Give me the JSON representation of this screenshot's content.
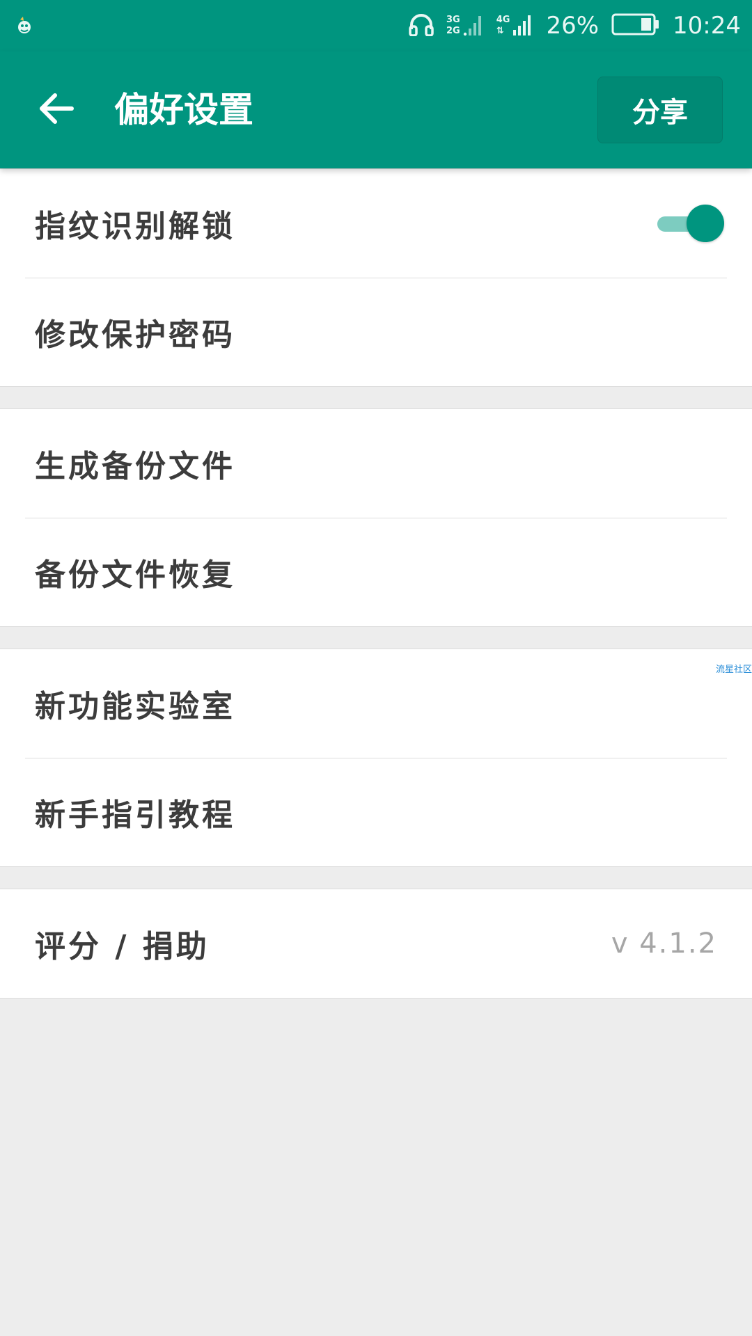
{
  "status_bar": {
    "network_1": [
      "3G",
      "2G"
    ],
    "network_2": "4G",
    "battery_percent": "26%",
    "battery_level": 0.26,
    "time": "10:24",
    "icons": [
      "notification-app-icon",
      "headphones-icon",
      "signal-icon",
      "battery-icon"
    ]
  },
  "app_bar": {
    "title": "偏好设置",
    "back_icon": "arrow-left-icon",
    "share_label": "分享"
  },
  "sections": [
    {
      "items": [
        {
          "label": "指纹识别解锁",
          "toggle_on": true
        },
        {
          "label": "修改保护密码"
        }
      ]
    },
    {
      "items": [
        {
          "label": "生成备份文件"
        },
        {
          "label": "备份文件恢复"
        }
      ]
    },
    {
      "items": [
        {
          "label": "新功能实验室"
        },
        {
          "label": "新手指引教程"
        }
      ]
    },
    {
      "items": [
        {
          "label": "评分 / 捐助",
          "value": "v 4.1.2"
        }
      ]
    }
  ],
  "watermark": "流星社区",
  "colors": {
    "primary": "#00957f",
    "toggle_track": "#7dccc0",
    "background": "#ededed",
    "text": "#3c3c3c",
    "secondary_text": "#a6a6a6"
  }
}
